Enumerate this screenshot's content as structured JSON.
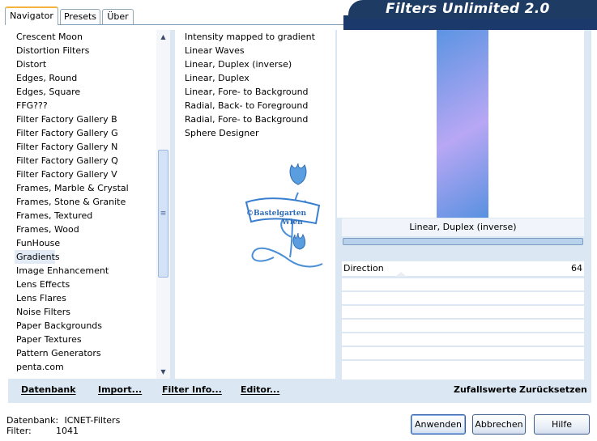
{
  "tabs": [
    "Navigator",
    "Presets",
    "Über"
  ],
  "app_title": "Filters Unlimited 2.0",
  "categories": [
    "Crescent Moon",
    "Distortion Filters",
    "Distort",
    "Edges, Round",
    "Edges, Square",
    "FFG???",
    "Filter Factory Gallery B",
    "Filter Factory Gallery G",
    "Filter Factory Gallery N",
    "Filter Factory Gallery Q",
    "Filter Factory Gallery V",
    "Frames, Marble & Crystal",
    "Frames, Stone & Granite",
    "Frames, Textured",
    "Frames, Wood",
    "FunHouse",
    "Gradients",
    "Image Enhancement",
    "Lens Effects",
    "Lens Flares",
    "Noise Filters",
    "Paper Backgrounds",
    "Paper Textures",
    "Pattern Generators",
    "penta.com"
  ],
  "selected_category": "Gradients",
  "filters": [
    "Intensity mapped to gradient",
    "Linear Waves",
    "Linear, Duplex (inverse)",
    "Linear, Duplex",
    "Linear, Fore- to Background",
    "Radial, Back- to Foreground",
    "Radial, Fore- to Background",
    "Sphere Designer"
  ],
  "selected_filter": "Linear, Duplex (inverse)",
  "preview": {
    "filter_name": "Linear, Duplex (inverse)",
    "gradient_colors": [
      "#5b94e2",
      "#b8a7f4",
      "#5891e0"
    ]
  },
  "params": {
    "label": "Direction",
    "value": "64"
  },
  "watermark": {
    "line1": "©Bastelgarten",
    "line2": "Wien"
  },
  "bottom_left": {
    "datenbank": "Datenbank",
    "import": "Import...",
    "filter_info": "Filter Info...",
    "editor": "Editor..."
  },
  "bottom_right": {
    "zufallswerte": "Zufallswerte",
    "zuruecksetzen": "Zurücksetzen"
  },
  "footer": {
    "db_label": "Datenbank:",
    "db_value": "ICNET-Filters",
    "filter_label": "Filter:",
    "filter_value": "1041"
  },
  "buttons": {
    "apply": "Anwenden",
    "cancel": "Abbrechen",
    "help": "Hilfe"
  }
}
